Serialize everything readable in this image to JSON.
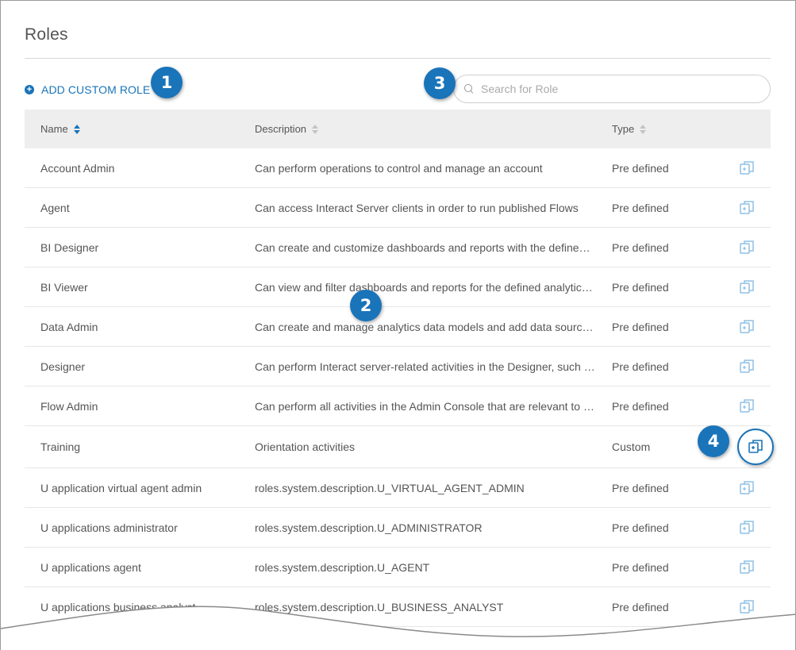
{
  "page": {
    "title": "Roles"
  },
  "toolbar": {
    "add_label": "ADD CUSTOM ROLE",
    "add_icon": "plus-circle-icon"
  },
  "search": {
    "placeholder": "Search for Role",
    "value": "",
    "icon": "search-icon"
  },
  "callouts": [
    "1",
    "2",
    "3",
    "4"
  ],
  "table": {
    "headers": {
      "name": "Name",
      "description": "Description",
      "type": "Type"
    },
    "rows": [
      {
        "name": "Account Admin",
        "description": "Can perform operations to control and manage an account",
        "type": "Pre defined"
      },
      {
        "name": "Agent",
        "description": "Can access Interact Server clients in order to run published Flows",
        "type": "Pre defined"
      },
      {
        "name": "BI Designer",
        "description": "Can create and customize dashboards and reports with the defined a...",
        "type": "Pre defined"
      },
      {
        "name": "BI Viewer",
        "description": "Can view and filter dashboards and reports for the defined analytics ...",
        "type": "Pre defined"
      },
      {
        "name": "Data Admin",
        "description": "Can create and manage analytics data models and add data sources.",
        "type": "Pre defined"
      },
      {
        "name": "Designer",
        "description": "Can perform Interact server-related activities in the Designer, such as...",
        "type": "Pre defined"
      },
      {
        "name": "Flow Admin",
        "description": "Can perform all activities in the Admin Console that are relevant to Fl...",
        "type": "Pre defined"
      },
      {
        "name": "Training",
        "description": "Orientation activities",
        "type": "Custom"
      },
      {
        "name": "U application virtual agent admin",
        "description": "roles.system.description.U_VIRTUAL_AGENT_ADMIN",
        "type": "Pre defined"
      },
      {
        "name": "U applications administrator",
        "description": "roles.system.description.U_ADMINISTRATOR",
        "type": "Pre defined"
      },
      {
        "name": "U applications agent",
        "description": "roles.system.description.U_AGENT",
        "type": "Pre defined"
      },
      {
        "name": "U applications business analyst",
        "description": "roles.system.description.U_BUSINESS_ANALYST",
        "type": "Pre defined"
      }
    ]
  },
  "colors": {
    "accent": "#1a74b9",
    "header_bg": "#eeeeee",
    "icon": "#8fc0e6"
  }
}
